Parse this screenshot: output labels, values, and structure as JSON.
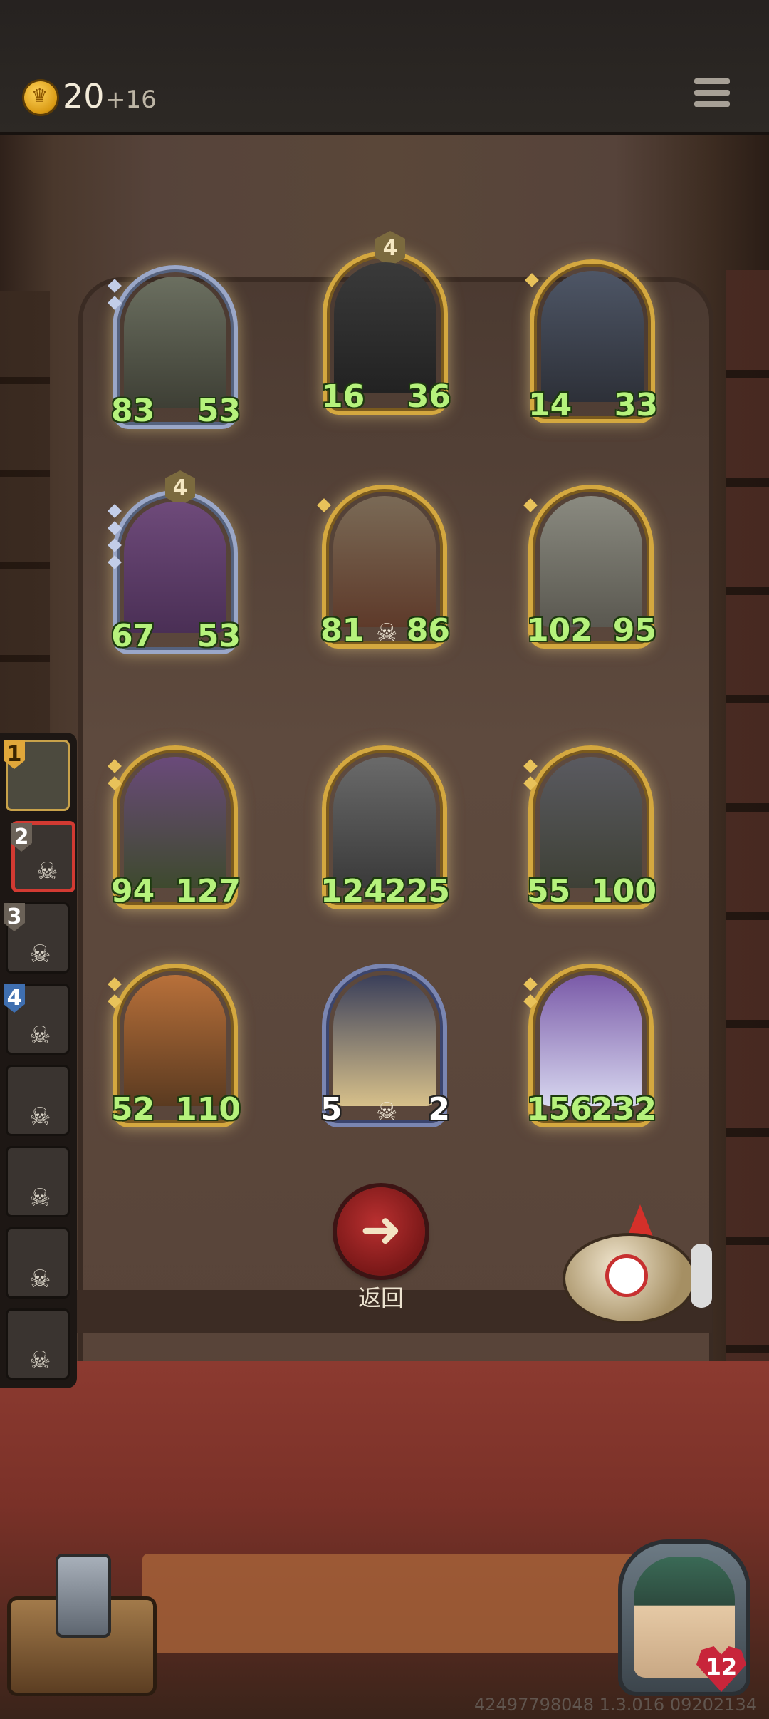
{
  "top_bar": {
    "gold": "20",
    "gold_income": "+16"
  },
  "minions": [
    {
      "attack": "83",
      "health": "53",
      "tier": "",
      "style": "silver"
    },
    {
      "attack": "16",
      "health": "36",
      "tier": "4",
      "style": "gold"
    },
    {
      "attack": "14",
      "health": "33",
      "tier": "",
      "style": "gold"
    },
    {
      "attack": "67",
      "health": "53",
      "tier": "4",
      "style": "silver"
    },
    {
      "attack": "81",
      "health": "86",
      "tier": "",
      "style": "gold"
    },
    {
      "attack": "102",
      "health": "95",
      "tier": "",
      "style": "gold"
    },
    {
      "attack": "94",
      "health": "127",
      "tier": "",
      "style": "gold"
    },
    {
      "attack": "124",
      "health": "225",
      "tier": "",
      "style": "gold"
    },
    {
      "attack": "55",
      "health": "100",
      "tier": "",
      "style": "gold"
    },
    {
      "attack": "52",
      "health": "110",
      "tier": "",
      "style": "gold"
    },
    {
      "attack": "5",
      "health": "2",
      "tier": "",
      "style": "blue"
    },
    {
      "attack": "156",
      "health": "232",
      "tier": "",
      "style": "gold"
    }
  ],
  "players": [
    {
      "rank": "1"
    },
    {
      "rank": "2"
    },
    {
      "rank": "3"
    },
    {
      "rank": "4"
    },
    {
      "rank": ""
    },
    {
      "rank": ""
    },
    {
      "rank": ""
    },
    {
      "rank": ""
    }
  ],
  "back_button": {
    "label": "返回",
    "icon": "arrow-left-icon"
  },
  "hero": {
    "health": "12"
  },
  "build_id": "42497798048 1.3.016 09202134",
  "colors": {
    "stat_green": "#b6f27c",
    "gold_border": "#d4a83f",
    "back_red": "#b93030"
  }
}
